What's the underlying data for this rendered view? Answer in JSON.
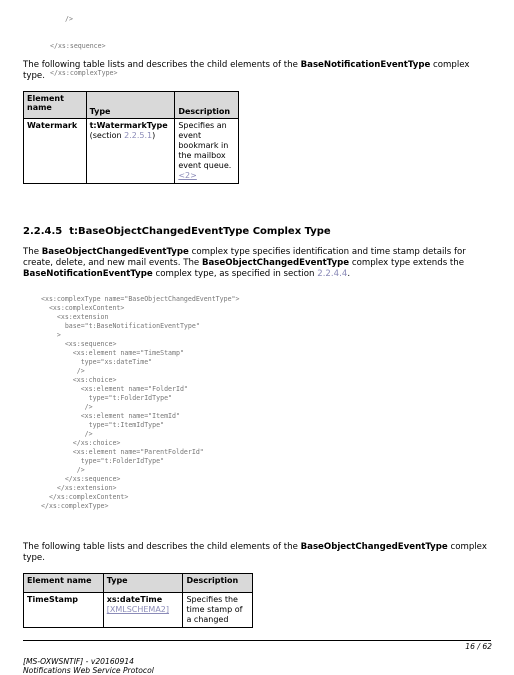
{
  "top_code": [
    "/>",
    "</xs:sequence>",
    "</xs:complexType>"
  ],
  "intro1": {
    "before": "The following table lists and describes the child elements of the ",
    "bold": "BaseNotificationEventType",
    "after": " complex type."
  },
  "table1": {
    "headers": [
      "Element name",
      "Type",
      "Description"
    ],
    "row": {
      "name": "Watermark",
      "type": "t:WatermarkType",
      "type_ref_pre": "(section ",
      "type_ref_link": "2.2.5.1",
      "type_ref_post": ")",
      "desc": "Specifies an event bookmark in the mailbox event queue.",
      "desc_link": "<2>"
    }
  },
  "section": {
    "number": "2.2.4.5",
    "title": "t:BaseObjectChangedEventType Complex Type"
  },
  "para2": {
    "t1": "The ",
    "b1": "BaseObjectChangedEventType",
    "t2": " complex type specifies identification and time stamp details for create, delete, and new mail events. The ",
    "b2": "BaseObjectChangedEventType",
    "t3": " complex type extends the ",
    "b3": "BaseNotificationEventType",
    "t4": " complex type, as specified in section ",
    "link": "2.2.4.4",
    "t5": "."
  },
  "schema_code": [
    "<xs:complexType name=\"BaseObjectChangedEventType\">",
    "  <xs:complexContent>",
    "    <xs:extension",
    "      base=\"t:BaseNotificationEventType\"",
    "    >",
    "      <xs:sequence>",
    "        <xs:element name=\"TimeStamp\"",
    "          type=\"xs:dateTime\"",
    "         />",
    "        <xs:choice>",
    "          <xs:element name=\"FolderId\"",
    "            type=\"t:FolderIdType\"",
    "           />",
    "          <xs:element name=\"ItemId\"",
    "            type=\"t:ItemIdType\"",
    "           />",
    "        </xs:choice>",
    "        <xs:element name=\"ParentFolderId\"",
    "          type=\"t:FolderIdType\"",
    "         />",
    "      </xs:sequence>",
    "    </xs:extension>",
    "  </xs:complexContent>",
    "</xs:complexType>"
  ],
  "intro2": {
    "before": "The following table lists and describes the child elements of the ",
    "bold": "BaseObjectChangedEventType",
    "after": " complex type."
  },
  "table2": {
    "headers": [
      "Element name",
      "Type",
      "Description"
    ],
    "row": {
      "name": "TimeStamp",
      "type": "xs:dateTime",
      "type_ref": "[XMLSCHEMA2]",
      "desc": "Specifies the time stamp of a changed"
    }
  },
  "footer": {
    "page": "16 / 62",
    "line1": "[MS-OXWSNTIF] - v20160914",
    "line2": "Notifications Web Service Protocol"
  }
}
